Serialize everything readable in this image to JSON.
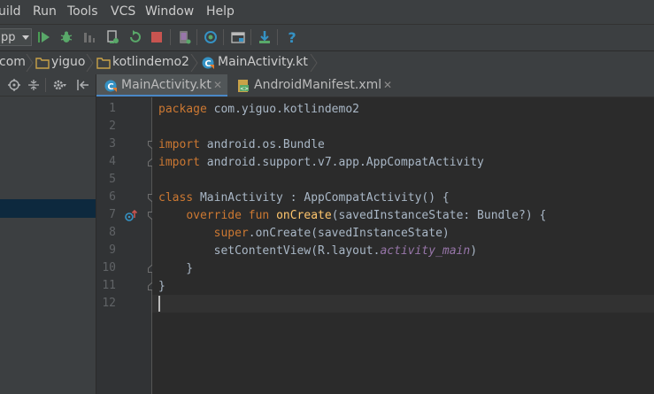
{
  "menu": [
    "uild",
    "Run",
    "Tools",
    "VCS",
    "Window",
    "Help"
  ],
  "toolbar": {
    "run_config": "pp",
    "icons": [
      "run-icon",
      "debug-icon",
      "attach-debugger-icon",
      "apply-changes-icon",
      "restart-icon",
      "stop-icon",
      "avd-manager-icon",
      "sync-gradle-icon",
      "project-structure-icon",
      "sdk-manager-icon",
      "help-icon"
    ]
  },
  "breadcrumbs": [
    "com",
    "yiguo",
    "kotlindemo2",
    "MainActivity.kt"
  ],
  "tabs": [
    {
      "label": "MainActivity.kt",
      "active": true
    },
    {
      "label": "AndroidManifest.xml",
      "active": false
    }
  ],
  "colors": {
    "keyword": "#cc7832",
    "function": "#ffc66d",
    "plain": "#a9b7c6",
    "member": "#9876aa"
  },
  "code": {
    "line_numbers": [
      "1",
      "2",
      "3",
      "4",
      "5",
      "6",
      "7",
      "8",
      "9",
      "10",
      "11",
      "12"
    ],
    "l1_kw": "package",
    "l1_rest": " com.yiguo.kotlindemo2",
    "l3_kw": "import",
    "l3_rest": " android.os.Bundle",
    "l4_kw": "import",
    "l4_rest": " android.support.v7.app.AppCompatActivity",
    "l6_kw": "class",
    "l6_rest": " MainActivity : AppCompatActivity() {",
    "l7_indent": "    ",
    "l7_kw": "override fun",
    "l7_sp": " ",
    "l7_fn": "onCreate",
    "l7_rest": "(savedInstanceState: Bundle?) {",
    "l8_indent": "        ",
    "l8_kw": "super",
    "l8_rest": ".onCreate(savedInstanceState)",
    "l9_indent": "        ",
    "l9_pre": "setContentView(R.layout.",
    "l9_it": "activity_main",
    "l9_post": ")",
    "l10": "    }",
    "l11": "}"
  }
}
